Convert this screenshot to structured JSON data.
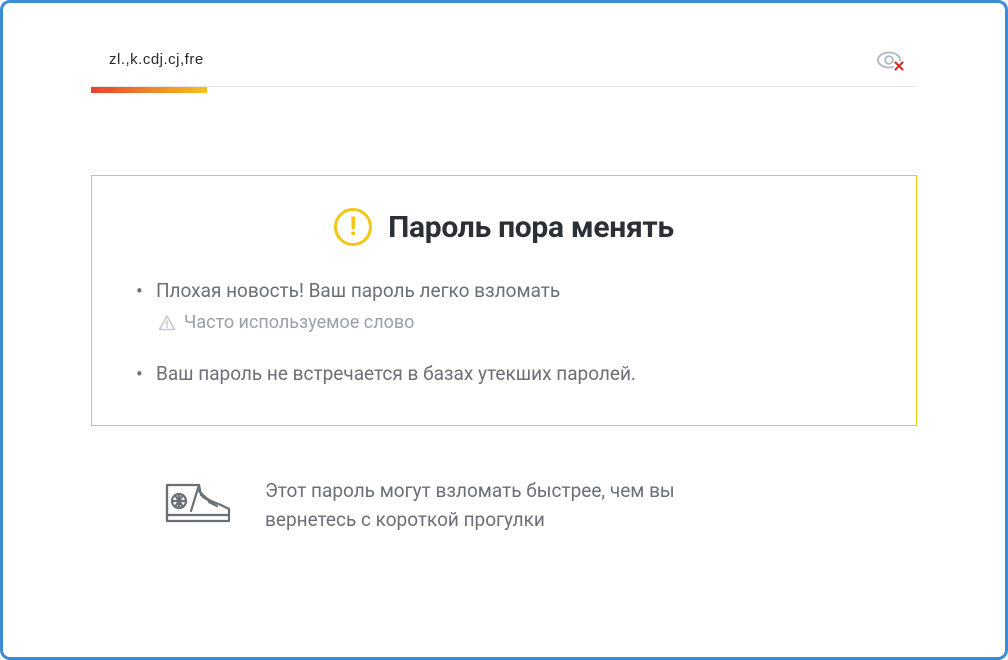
{
  "input": {
    "value": "zl.,k.cdj.cj,fre"
  },
  "strength": {
    "percent": 14
  },
  "warning": {
    "title": "Пароль пора менять",
    "items": [
      {
        "text": "Плохая новость! Ваш пароль легко взломать",
        "sub": "Часто используемое слово"
      },
      {
        "text": "Ваш пароль не встречается в базах утекших паролей."
      }
    ]
  },
  "footer": {
    "line1": "Этот пароль могут взломать быстрее, чем вы",
    "line2": "вернетесь с короткой прогулки"
  },
  "colors": {
    "frame_border": "#3a8cd6",
    "warn_border": "#f1c40e",
    "warn_icon": "#f2c615",
    "text_muted": "#6a7078"
  }
}
